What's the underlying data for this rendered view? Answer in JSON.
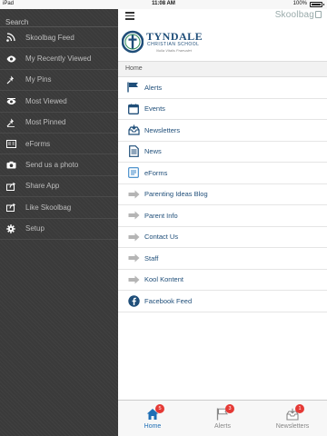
{
  "status_bar": {
    "carrier": "iPad",
    "time": "11:08 AM",
    "battery": "100%"
  },
  "drawer": {
    "search_label": "Search",
    "items": [
      {
        "label": "Skoolbag Feed",
        "icon": "rss-icon"
      },
      {
        "label": "My Recently Viewed",
        "icon": "eye-icon"
      },
      {
        "label": "My Pins",
        "icon": "pin-icon"
      },
      {
        "label": "Most Viewed",
        "icon": "eye-icon"
      },
      {
        "label": "Most Pinned",
        "icon": "pin-icon"
      },
      {
        "label": "eForms",
        "icon": "form-icon"
      },
      {
        "label": "Send us a photo",
        "icon": "camera-icon"
      },
      {
        "label": "Share App",
        "icon": "share-icon"
      },
      {
        "label": "Like Skoolbag",
        "icon": "share-icon"
      },
      {
        "label": "Setup",
        "icon": "gear-icon"
      }
    ]
  },
  "header": {
    "brand": "Skoolbag",
    "school_name": "TYNDALE",
    "school_sub": "CHRISTIAN SCHOOL",
    "school_motto": "Nulla Vitalis Praevalet"
  },
  "breadcrumb": "Home",
  "content": {
    "items": [
      {
        "label": "Alerts",
        "icon": "flag-icon"
      },
      {
        "label": "Events",
        "icon": "calendar-icon"
      },
      {
        "label": "Newsletters",
        "icon": "inbox-icon"
      },
      {
        "label": "News",
        "icon": "document-icon"
      },
      {
        "label": "eForms",
        "icon": "form-icon"
      },
      {
        "label": "Parenting Ideas Blog",
        "icon": "arrow-right-icon"
      },
      {
        "label": "Parent Info",
        "icon": "arrow-right-icon"
      },
      {
        "label": "Contact Us",
        "icon": "arrow-right-icon"
      },
      {
        "label": "Staff",
        "icon": "arrow-right-icon"
      },
      {
        "label": "Kool Kontent",
        "icon": "arrow-right-icon"
      },
      {
        "label": "Facebook Feed",
        "icon": "facebook-icon"
      }
    ]
  },
  "tabbar": {
    "tabs": [
      {
        "label": "Home",
        "badge": "5",
        "active": true,
        "icon": "home-icon"
      },
      {
        "label": "Alerts",
        "badge": "3",
        "active": false,
        "icon": "flag-icon"
      },
      {
        "label": "Newsletters",
        "badge": "1",
        "active": false,
        "icon": "inbox-icon"
      }
    ]
  },
  "colors": {
    "accent": "#1f4e79",
    "badge": "#e53935",
    "drawer_bg": "#3a3a3a",
    "tab_active": "#1f6fb5"
  }
}
